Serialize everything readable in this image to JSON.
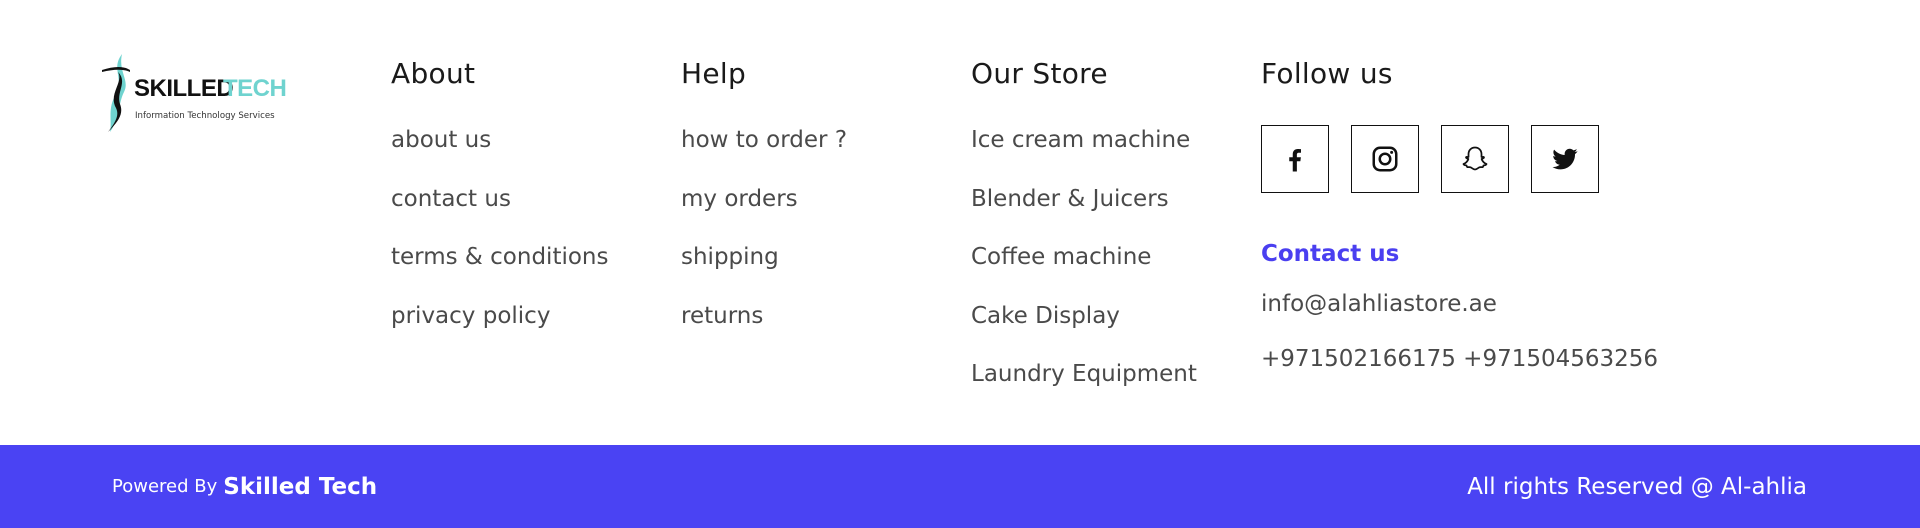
{
  "logo": {
    "brand_first": "SKILLED",
    "brand_second": "TECH",
    "tagline": "Information Technology Services",
    "colors": {
      "dark": "#111111",
      "teal": "#6fd3cf"
    }
  },
  "about": {
    "heading": "About",
    "links": [
      "about us",
      "contact us",
      "terms & conditions",
      "privacy policy"
    ]
  },
  "help": {
    "heading": "Help",
    "links": [
      "how to order ?",
      "my orders",
      "shipping",
      "returns"
    ]
  },
  "store": {
    "heading": "Our Store",
    "links": [
      "Ice cream machine",
      "Blender & Juicers",
      "Coffee machine",
      "Cake Display",
      "Laundry Equipment"
    ]
  },
  "follow": {
    "heading": "Follow us",
    "socials": [
      "facebook-icon",
      "instagram-icon",
      "snapchat-icon",
      "twitter-icon"
    ],
    "contact_title": "Contact us",
    "email": "info@alahliastore.ae",
    "phones": "+971502166175 +971504563256"
  },
  "bar": {
    "powered_by": "Powered By",
    "powered_brand": "Skilled Tech",
    "rights": "All rights Reserved @ Al-ahlia"
  },
  "colors": {
    "accent": "#4a43f3",
    "contact_title": "#4a3ff0",
    "link_text": "#4a4a4a"
  }
}
